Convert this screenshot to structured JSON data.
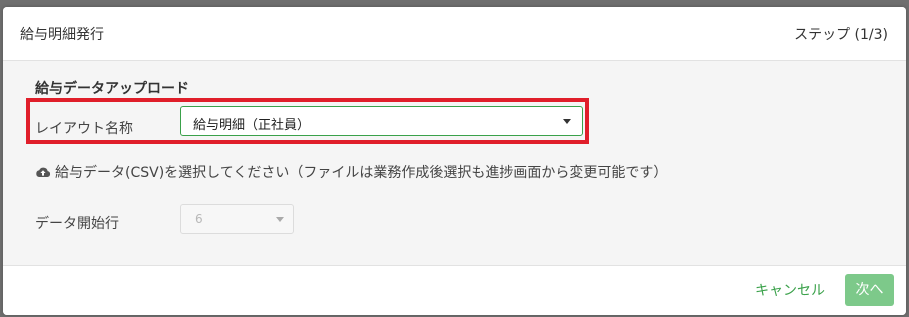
{
  "dialog": {
    "title": "給与明細発行",
    "step": "ステップ (1/3)"
  },
  "section": {
    "title": "給与データアップロード"
  },
  "layout_field": {
    "label": "レイアウト名称",
    "value": "給与明細（正社員）"
  },
  "upload": {
    "icon": "cloud-upload-icon",
    "text": "給与データ(CSV)を選択してください（ファイルは業務作成後選択も進捗画面から変更可能です）"
  },
  "start_row_field": {
    "label": "データ開始行",
    "value": "6"
  },
  "footer": {
    "cancel_label": "キャンセル",
    "next_label": "次へ"
  },
  "colors": {
    "accent": "#3aa14a",
    "highlight": "#e01e2a",
    "next_button": "#7dc98a"
  }
}
